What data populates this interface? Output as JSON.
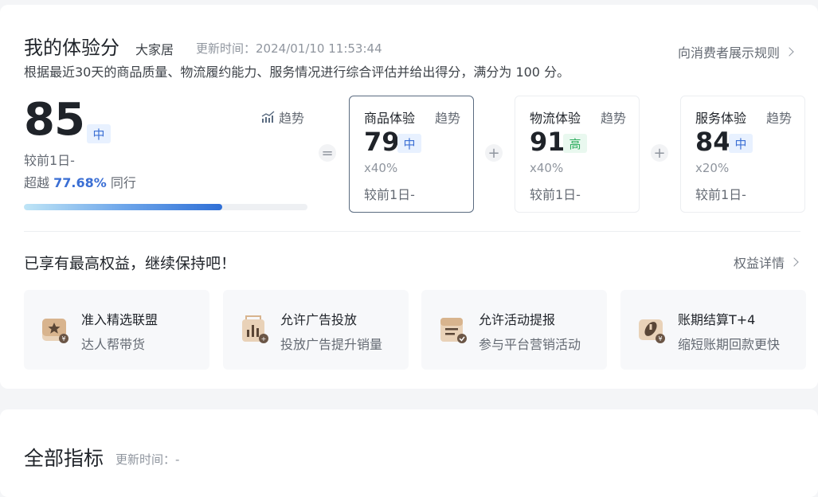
{
  "header": {
    "title": "我的体验分",
    "store_tag": "大家居",
    "update_label": "更新时间：",
    "update_time": "2024/01/10 11:53:44",
    "description": "根据最近30天的商品质量、物流履约能力、服务情况进行综合评估并给出得分，满分为 100 分。",
    "rules_link": "向消费者展示规则"
  },
  "overall": {
    "score": "85",
    "level": "中",
    "compare_label": "较前1日-",
    "beat_prefix": "超越",
    "beat_percent": "77.68%",
    "beat_suffix": "同行",
    "trend_label": "趋势",
    "progress_percent": 70
  },
  "operators": {
    "equals": "=",
    "plus": "+"
  },
  "sub_scores": [
    {
      "name": "商品体验",
      "trend": "趋势",
      "score": "79",
      "level": "中",
      "weight": "x40%",
      "compare": "较前1日-"
    },
    {
      "name": "物流体验",
      "trend": "趋势",
      "score": "91",
      "level": "高",
      "weight": "x40%",
      "compare": "较前1日-"
    },
    {
      "name": "服务体验",
      "trend": "趋势",
      "score": "84",
      "level": "中",
      "weight": "x20%",
      "compare": "较前1日-"
    }
  ],
  "benefits": {
    "title": "已享有最高权益，继续保持吧！",
    "detail_link": "权益详情",
    "items": [
      {
        "icon": "star-box-icon",
        "title": "准入精选联盟",
        "subtitle": "达人帮带货"
      },
      {
        "icon": "ad-chart-icon",
        "title": "允许广告投放",
        "subtitle": "投放广告提升销量"
      },
      {
        "icon": "activity-form-icon",
        "title": "允许活动提报",
        "subtitle": "参与平台营销活动"
      },
      {
        "icon": "wallet-clock-icon",
        "title": "账期结算T+4",
        "subtitle": "缩短账期回款更快"
      }
    ]
  },
  "all_metrics": {
    "title": "全部指标",
    "update_label": "更新时间：-"
  },
  "colors": {
    "accent_blue": "#3b6fd4",
    "level_high_green": "#2fae60",
    "icon_tan": "#c8a07a"
  }
}
